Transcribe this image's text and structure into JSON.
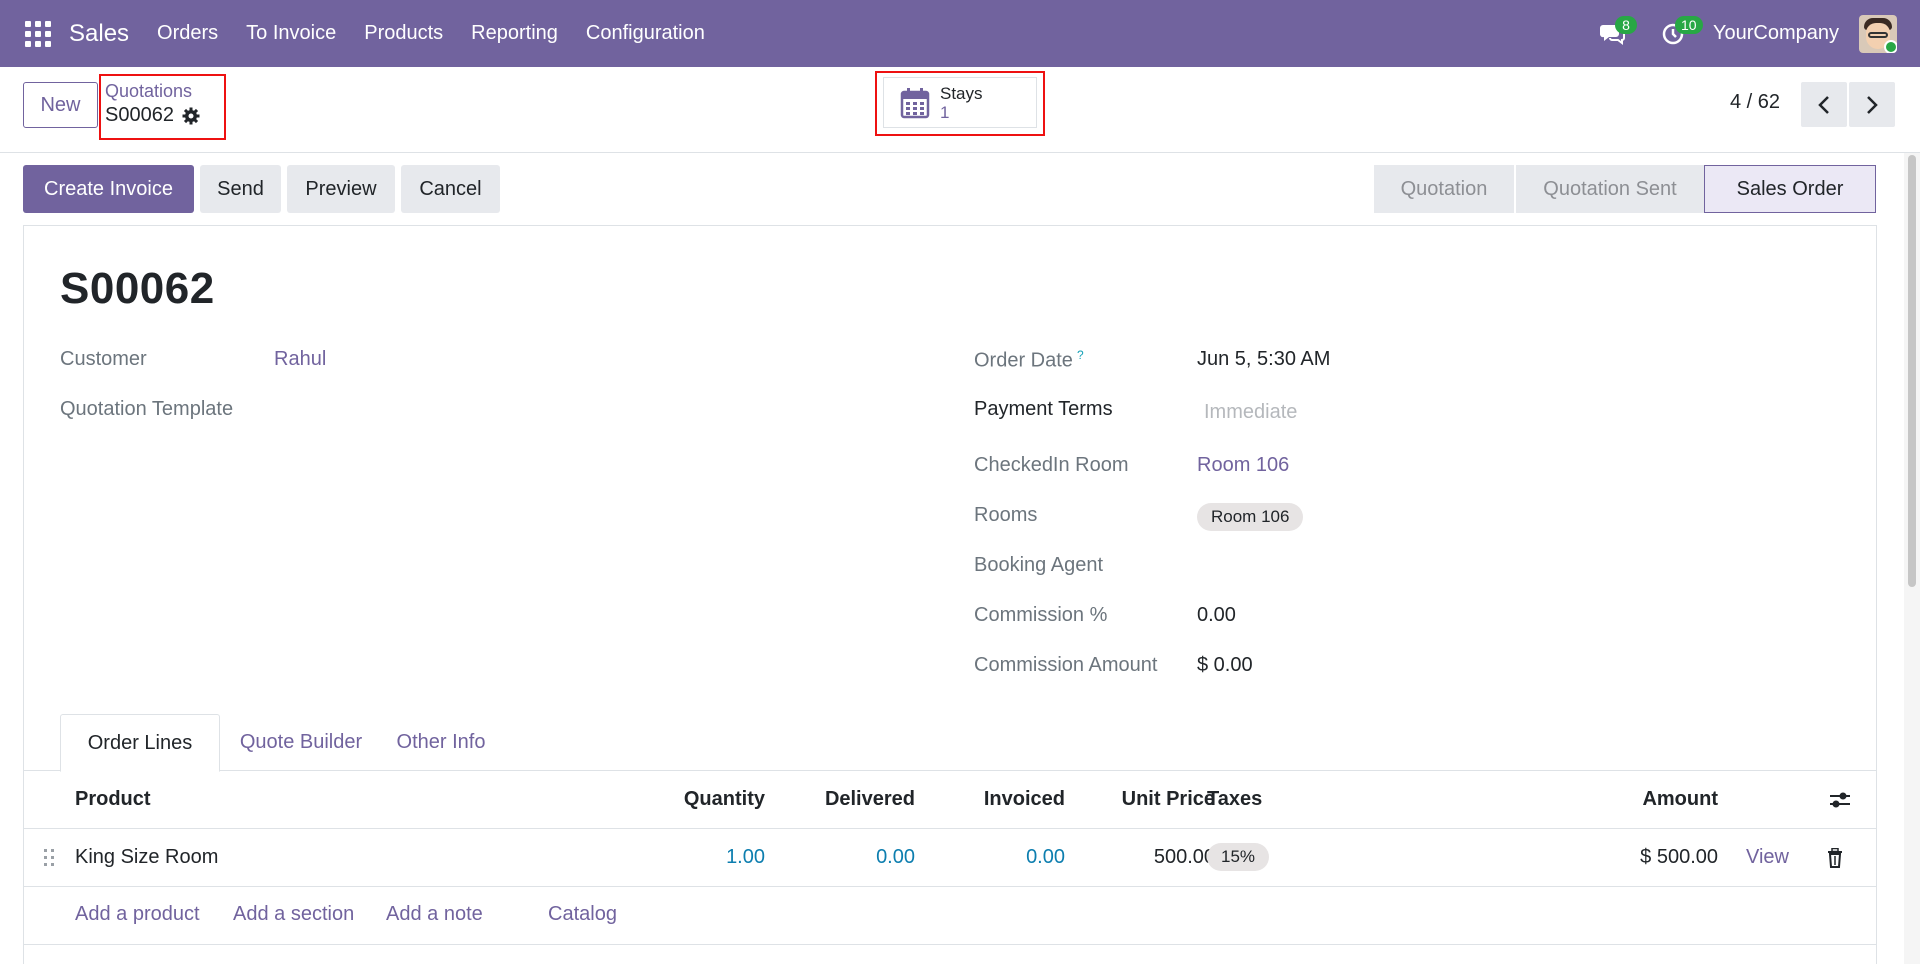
{
  "navbar": {
    "app_name": "Sales",
    "menu": [
      "Orders",
      "To Invoice",
      "Products",
      "Reporting",
      "Configuration"
    ],
    "messages_count": "8",
    "activities_count": "10",
    "company": "YourCompany",
    "color": "#71639e"
  },
  "control": {
    "new_label": "New",
    "breadcrumb_parent": "Quotations",
    "breadcrumb_current": "S00062",
    "stat_label": "Stays",
    "stat_value": "1",
    "pager": "4 / 62"
  },
  "actions": {
    "create_invoice": "Create Invoice",
    "send": "Send",
    "preview": "Preview",
    "cancel": "Cancel"
  },
  "statusbar": [
    "Quotation",
    "Quotation Sent",
    "Sales Order"
  ],
  "form": {
    "title": "S00062",
    "customer_label": "Customer",
    "customer_value": "Rahul",
    "quotation_template_label": "Quotation Template",
    "order_date_label": "Order Date",
    "order_date_help": "?",
    "order_date_value": "Jun 5, 5:30 AM",
    "payment_terms_label": "Payment Terms",
    "payment_terms_placeholder": "Immediate",
    "checkedin_room_label": "CheckedIn Room",
    "checkedin_room_value": "Room 106",
    "rooms_label": "Rooms",
    "rooms_tag": "Room 106",
    "booking_agent_label": "Booking Agent",
    "commission_pct_label": "Commission %",
    "commission_pct_value": "0.00",
    "commission_amount_label": "Commission Amount",
    "commission_amount_value": "$ 0.00"
  },
  "tabs": [
    "Order Lines",
    "Quote Builder",
    "Other Info"
  ],
  "order_lines": {
    "columns": [
      "Product",
      "Quantity",
      "Delivered",
      "Invoiced",
      "Unit Price",
      "Taxes",
      "Amount"
    ],
    "rows": [
      {
        "product": "King Size Room",
        "quantity": "1.00",
        "delivered": "0.00",
        "invoiced": "0.00",
        "unit_price": "500.00",
        "taxes": "15%",
        "amount": "$ 500.00",
        "view": "View"
      }
    ],
    "add_product": "Add a product",
    "add_section": "Add a section",
    "add_note": "Add a note",
    "catalog": "Catalog"
  }
}
